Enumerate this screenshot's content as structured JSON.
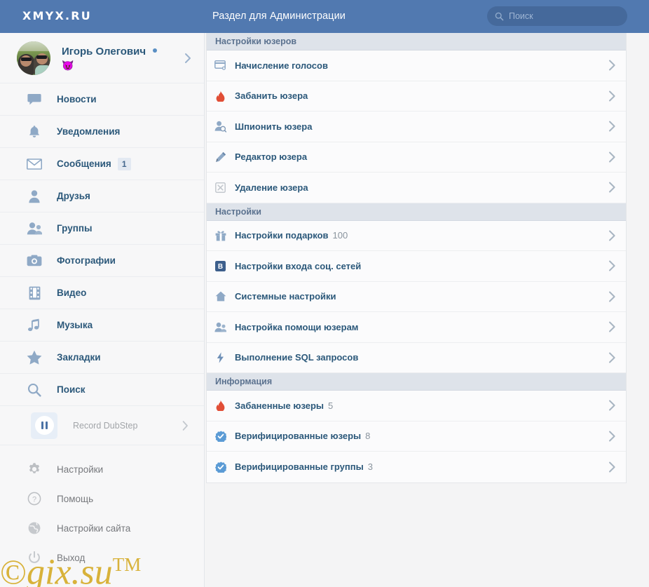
{
  "header": {
    "logo": "XMYX.RU",
    "title": "Раздел для Администрации",
    "search_placeholder": "Поиск",
    "search_value": "",
    "bg_color": "#5179b0"
  },
  "sidebar": {
    "profile": {
      "name": "Игорь Олегович",
      "status_emoji": "😈",
      "online": true
    },
    "nav": [
      {
        "label": "Новости",
        "icon": "comment-icon",
        "badge": ""
      },
      {
        "label": "Уведомления",
        "icon": "bell-icon",
        "badge": ""
      },
      {
        "label": "Сообщения",
        "icon": "envelope-icon",
        "badge": "1"
      },
      {
        "label": "Друзья",
        "icon": "user-icon",
        "badge": ""
      },
      {
        "label": "Группы",
        "icon": "users-icon",
        "badge": ""
      },
      {
        "label": "Фотографии",
        "icon": "camera-icon",
        "badge": ""
      },
      {
        "label": "Видео",
        "icon": "film-icon",
        "badge": ""
      },
      {
        "label": "Музыка",
        "icon": "music-note-icon",
        "badge": ""
      },
      {
        "label": "Закладки",
        "icon": "star-icon",
        "badge": ""
      },
      {
        "label": "Поиск",
        "icon": "search-icon",
        "badge": ""
      }
    ],
    "player": {
      "track": "Record DubStep",
      "state": "pause-icon"
    },
    "nav_secondary": [
      {
        "label": "Настройки",
        "icon": "gear-icon"
      },
      {
        "label": "Помощь",
        "icon": "question-circle-icon"
      },
      {
        "label": "Настройки сайта",
        "icon": "globe-icon"
      },
      {
        "label": "Выход",
        "icon": "power-icon"
      }
    ]
  },
  "watermark": {
    "copyright": "©",
    "text": "gix.su",
    "tm": "TM"
  },
  "main": {
    "sections": [
      {
        "title": "Настройки юзеров",
        "rows": [
          {
            "label": "Начисление голосов",
            "count": "",
            "icon": "card-add-icon"
          },
          {
            "label": "Забанить юзера",
            "count": "",
            "icon": "fire-icon"
          },
          {
            "label": "Шпионить юзера",
            "count": "",
            "icon": "user-search-icon"
          },
          {
            "label": "Редактор юзера",
            "count": "",
            "icon": "pencil-icon"
          },
          {
            "label": "Удаление юзера",
            "count": "",
            "icon": "close-box-icon"
          }
        ]
      },
      {
        "title": "Настройки",
        "rows": [
          {
            "label": "Настройки подарков",
            "count": "100",
            "icon": "gift-icon"
          },
          {
            "label": "Настройки входа соц. сетей",
            "count": "",
            "icon": "vk-icon"
          },
          {
            "label": "Системные настройки",
            "count": "",
            "icon": "home-icon"
          },
          {
            "label": "Настройка помощи юзерам",
            "count": "",
            "icon": "users-icon"
          },
          {
            "label": "Выполнение SQL запросов",
            "count": "",
            "icon": "bolt-icon"
          }
        ]
      },
      {
        "title": "Информация",
        "rows": [
          {
            "label": "Забаненные юзеры",
            "count": "5",
            "icon": "fire-icon"
          },
          {
            "label": "Верифицированные юзеры",
            "count": "8",
            "icon": "verified-icon"
          },
          {
            "label": "Верифицированные группы",
            "count": "3",
            "icon": "verified-icon"
          }
        ]
      }
    ]
  }
}
